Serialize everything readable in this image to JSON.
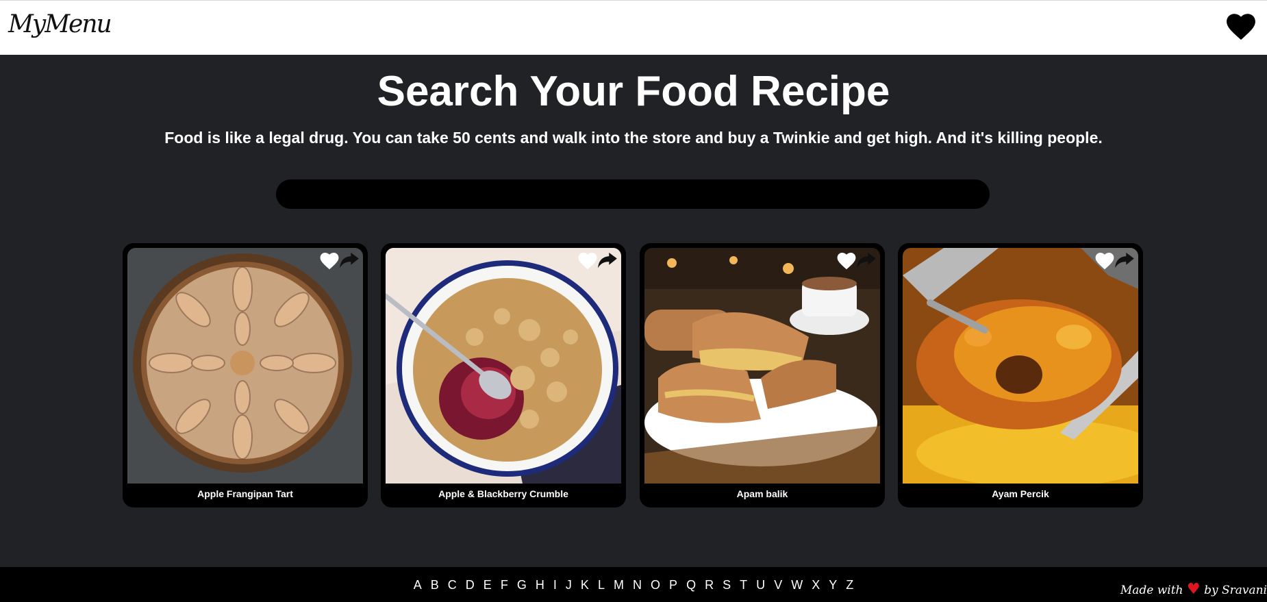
{
  "header": {
    "logo": "MyMenu",
    "favorites_icon": "heart-icon"
  },
  "hero": {
    "title": "Search Your Food Recipe",
    "quote": "Food is like a legal drug. You can take 50 cents and walk into the store and buy a Twinkie and get high. And it's killing people."
  },
  "search": {
    "value": "",
    "placeholder": ""
  },
  "recipes": [
    {
      "title": "Apple Frangipan Tart",
      "icons": [
        "heart-icon",
        "share-icon"
      ]
    },
    {
      "title": "Apple & Blackberry Crumble",
      "icons": [
        "heart-icon",
        "share-icon"
      ]
    },
    {
      "title": "Apam balik",
      "icons": [
        "heart-icon",
        "share-icon"
      ]
    },
    {
      "title": "Ayam Percik",
      "icons": [
        "heart-icon",
        "share-icon"
      ]
    }
  ],
  "footer": {
    "letters": [
      "A",
      "B",
      "C",
      "D",
      "E",
      "F",
      "G",
      "H",
      "I",
      "J",
      "K",
      "L",
      "M",
      "N",
      "O",
      "P",
      "Q",
      "R",
      "S",
      "T",
      "U",
      "V",
      "W",
      "X",
      "Y",
      "Z"
    ],
    "credit_prefix": "Made with",
    "credit_suffix": "by Sravani"
  },
  "colors": {
    "background": "#202226",
    "header_bg": "#ffffff",
    "card_bg": "#000000",
    "footer_bg": "#000000",
    "credit_heart": "#e0161f"
  }
}
